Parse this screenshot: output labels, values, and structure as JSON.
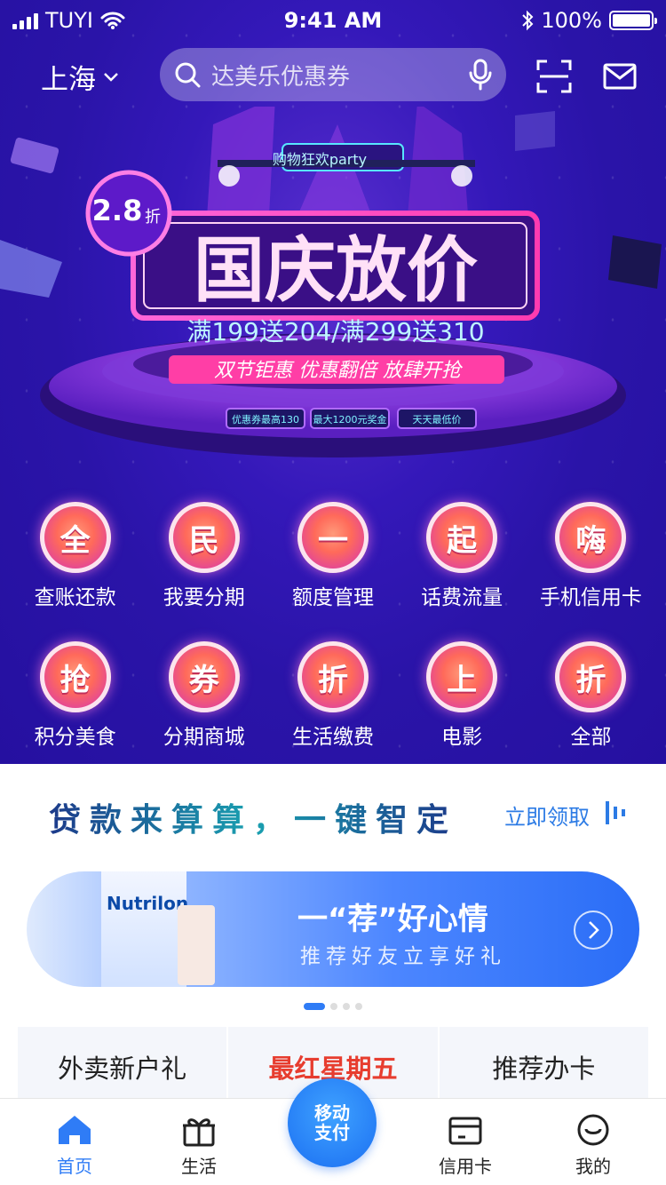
{
  "status": {
    "carrier": "TUYI",
    "time": "9:41 AM",
    "battery": "100%"
  },
  "topbar": {
    "city": "上海",
    "search_placeholder": "达美乐优惠券"
  },
  "hero": {
    "discount": "2.8",
    "discount_unit": "折",
    "sign": "购物狂欢party",
    "title": "国庆放价",
    "offer": "满199送204/满299送310",
    "slogan": "双节钜惠 优惠翻倍 放肆开抢",
    "chips": [
      "优惠券最高130",
      "最大1200元奖金",
      "天天最低价"
    ]
  },
  "grid": {
    "row1": [
      {
        "icon": "全",
        "label": "查账还款"
      },
      {
        "icon": "民",
        "label": "我要分期"
      },
      {
        "icon": "一",
        "label": "额度管理"
      },
      {
        "icon": "起",
        "label": "话费流量"
      },
      {
        "icon": "嗨",
        "label": "手机信用卡"
      }
    ],
    "row2": [
      {
        "icon": "抢",
        "label": "积分美食"
      },
      {
        "icon": "券",
        "label": "分期商城"
      },
      {
        "icon": "折",
        "label": "生活缴费"
      },
      {
        "icon": "上",
        "label": "电影"
      },
      {
        "icon": "折",
        "label": "全部"
      }
    ]
  },
  "loan": {
    "title": "贷款来算算，一键智定",
    "link": "立即领取"
  },
  "banner": {
    "title": "一“荐”好心情",
    "subtitle": "推荐好友立享好礼",
    "product": "Nutrilon"
  },
  "cards": [
    "外卖新户礼",
    "最红星期五",
    "推荐办卡"
  ],
  "tabs": {
    "home": "首页",
    "life": "生活",
    "pay": "移动支付",
    "card": "信用卡",
    "me": "我的"
  },
  "colors": {
    "accent": "#2f7cf6",
    "hero_bg": "#2a14a8",
    "hot": "#e73d2f"
  }
}
